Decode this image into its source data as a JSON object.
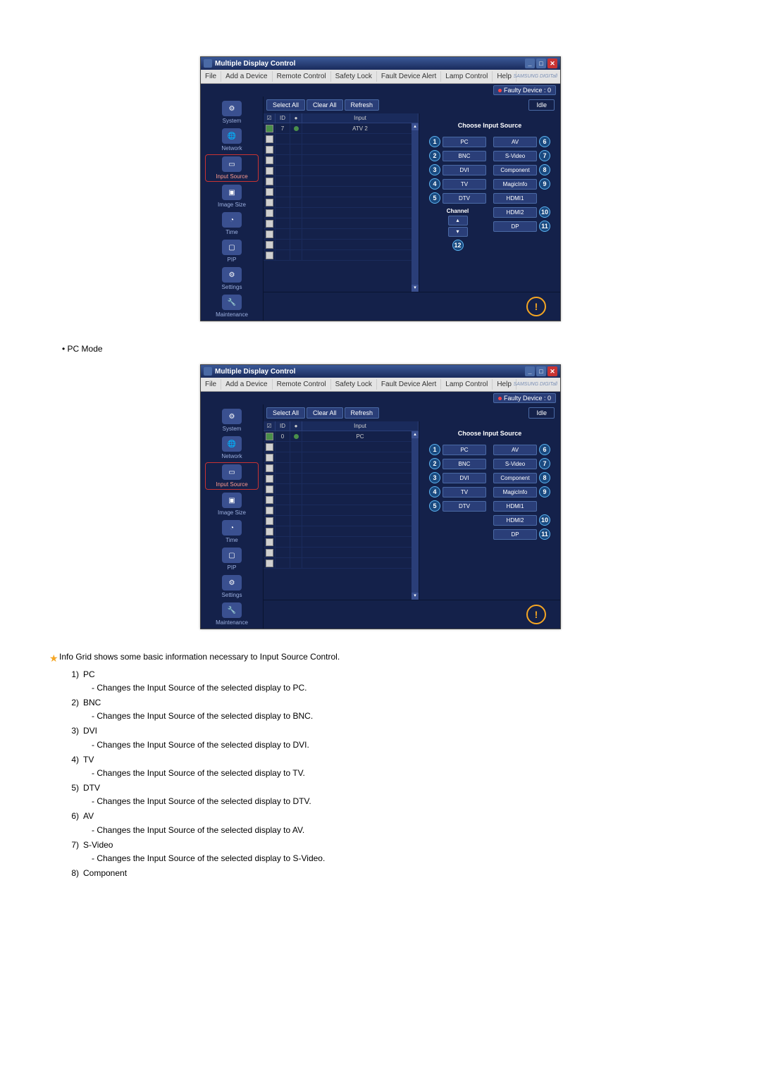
{
  "window": {
    "title": "Multiple Display Control",
    "brand": "SAMSUNG DIGITall"
  },
  "menu": {
    "file": "File",
    "add_device": "Add a Device",
    "remote_control": "Remote Control",
    "safety_lock": "Safety Lock",
    "fault_alert": "Fault Device Alert",
    "lamp_control": "Lamp Control",
    "help": "Help"
  },
  "faulty": {
    "label": "Faulty Device : 0"
  },
  "sidebar": {
    "items": [
      "System",
      "Network",
      "Input Source",
      "Image Size",
      "Time",
      "PIP",
      "Settings",
      "Maintenance"
    ]
  },
  "toolbar": {
    "select_all": "Select All",
    "clear_all": "Clear All",
    "refresh": "Refresh",
    "idle": "Idle"
  },
  "grid": {
    "headers": {
      "id": "ID",
      "input": "Input"
    },
    "row1_a": {
      "id": "7",
      "input": "ATV 2"
    },
    "row1_b": {
      "id": "0",
      "input": "PC"
    }
  },
  "panel": {
    "title": "Choose Input Source",
    "channel": "Channel",
    "buttons": {
      "pc": "PC",
      "bnc": "BNC",
      "dvi": "DVI",
      "tv": "TV",
      "dtv": "DTV",
      "av": "AV",
      "svideo": "S-Video",
      "component": "Component",
      "magicinfo": "MagicInfo",
      "hdmi1": "HDMI1",
      "hdmi2": "HDMI2",
      "dp": "DP"
    },
    "nums": {
      "n1": "1",
      "n2": "2",
      "n3": "3",
      "n4": "4",
      "n5": "5",
      "n6": "6",
      "n7": "7",
      "n8": "8",
      "n9": "9",
      "n10": "10",
      "n11": "11",
      "n12": "12"
    }
  },
  "text": {
    "mode_label": "PC Mode",
    "info_grid": "Info Grid shows some basic information necessary to Input Source Control.",
    "items": [
      {
        "n": "1)",
        "t": "PC",
        "d": "- Changes the Input Source of the selected display to PC."
      },
      {
        "n": "2)",
        "t": "BNC",
        "d": "- Changes the Input Source of the selected display to BNC."
      },
      {
        "n": "3)",
        "t": "DVI",
        "d": "- Changes the Input Source of the selected display to DVI."
      },
      {
        "n": "4)",
        "t": "TV",
        "d": "- Changes the Input Source of the selected display to TV."
      },
      {
        "n": "5)",
        "t": "DTV",
        "d": "- Changes the Input Source of the selected display to DTV."
      },
      {
        "n": "6)",
        "t": "AV",
        "d": "- Changes the Input Source of the selected display to AV."
      },
      {
        "n": "7)",
        "t": "S-Video",
        "d": "- Changes the Input Source of the selected display to S-Video."
      },
      {
        "n": "8)",
        "t": "Component",
        "d": ""
      }
    ]
  }
}
